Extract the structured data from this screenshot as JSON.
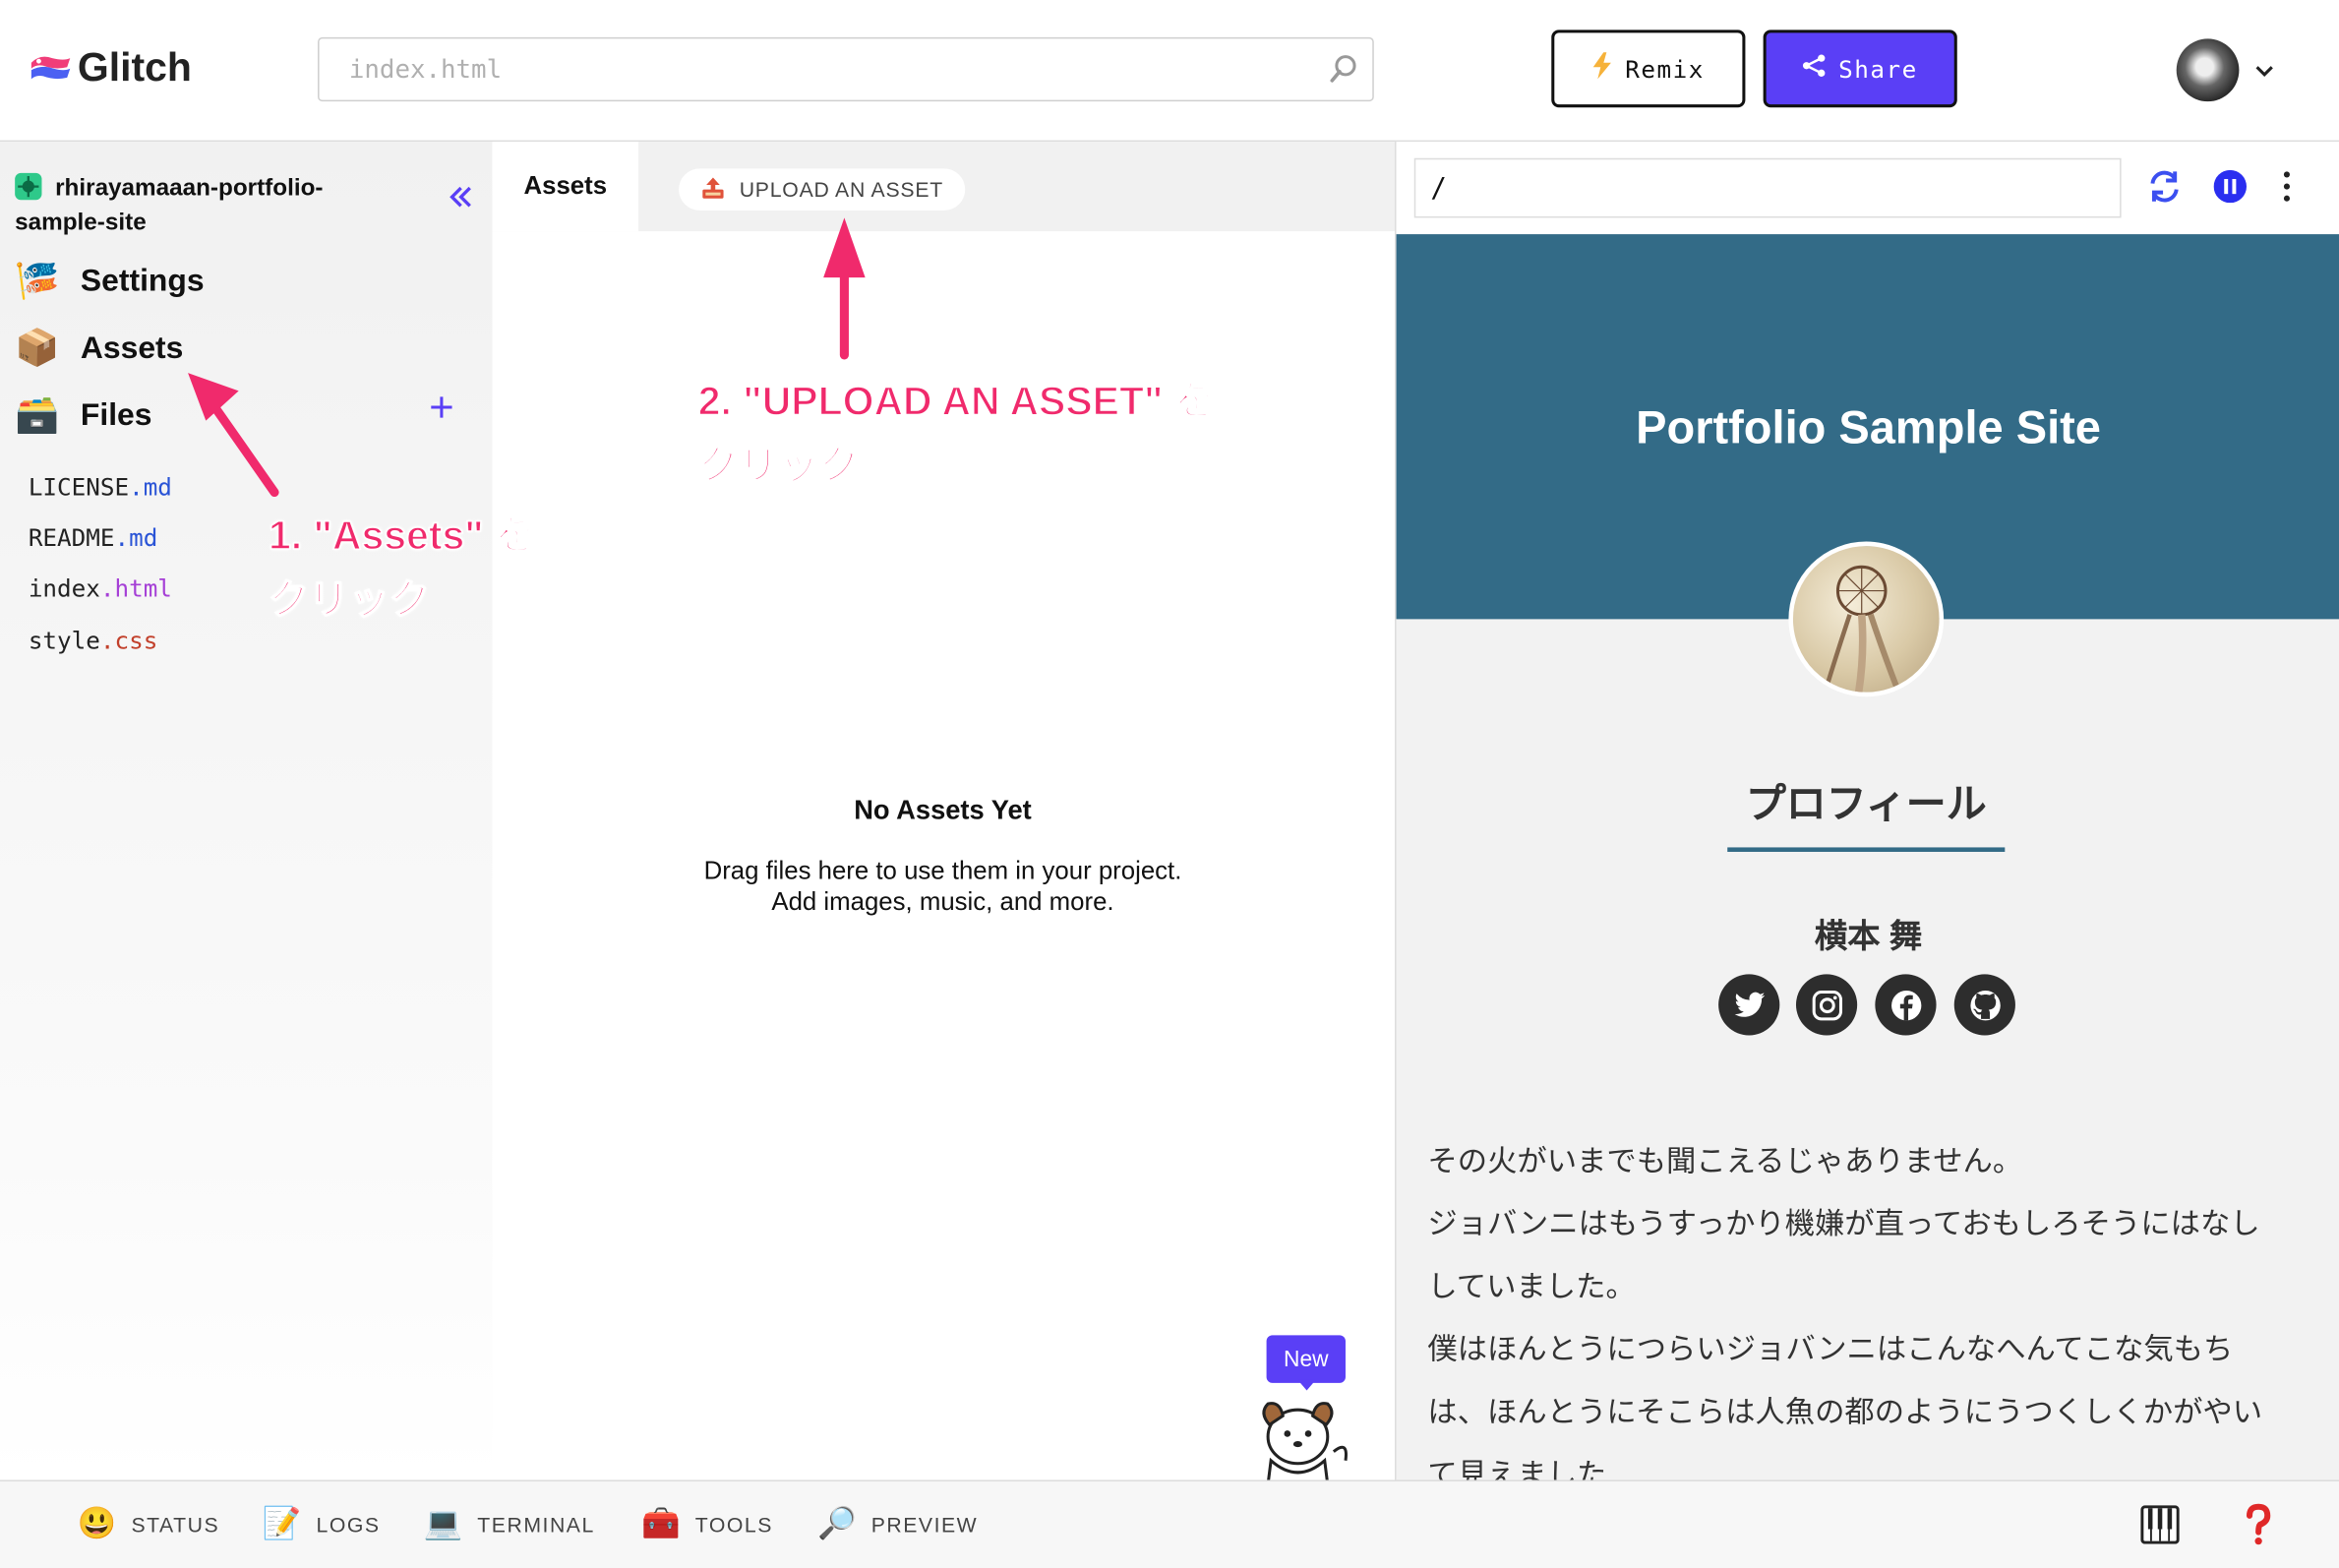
{
  "header": {
    "app_name": "Glitch",
    "search_placeholder": "index.html",
    "remix_label": "Remix",
    "share_label": "Share"
  },
  "sidebar": {
    "project_name": "rhirayamaaan-portfolio-sample-site",
    "nav": [
      {
        "label": "Settings",
        "icon": "carp-streamer-icon"
      },
      {
        "label": "Assets",
        "icon": "package-icon"
      },
      {
        "label": "Files",
        "icon": "file-cabinet-icon"
      }
    ],
    "files": [
      {
        "name": "LICENSE",
        "ext": ".md"
      },
      {
        "name": "README",
        "ext": ".md"
      },
      {
        "name": "index",
        "ext": ".html"
      },
      {
        "name": "style",
        "ext": ".css"
      }
    ]
  },
  "assets_panel": {
    "tab_label": "Assets",
    "upload_label": "UPLOAD AN ASSET",
    "empty_title": "No Assets Yet",
    "empty_line1": "Drag files here to use them in your project.",
    "empty_line2": "Add images, music, and more.",
    "new_badge": "New"
  },
  "preview": {
    "url": "/",
    "site_title": "Portfolio Sample Site",
    "profile_heading": "プロフィール",
    "person_name": "横本 舞",
    "social_icons": [
      "twitter-icon",
      "instagram-icon",
      "facebook-icon",
      "github-icon"
    ],
    "body_lines": [
      "その火がいまでも聞こえるじゃありません。",
      "ジョバンニはもうすっかり機嫌が直っておもしろそうにはなし",
      "していました。",
      "僕はほんとうにつらいジョバンニはこんなへんてこな気もち",
      "は、ほんとうにそこらは人魚の都のようにうつくしくかがやい",
      "て見えました"
    ]
  },
  "bottom_bar": {
    "items": [
      {
        "label": "STATUS",
        "icon": "smiley-icon"
      },
      {
        "label": "LOGS",
        "icon": "memo-icon"
      },
      {
        "label": "TERMINAL",
        "icon": "laptop-icon"
      },
      {
        "label": "TOOLS",
        "icon": "toolbox-icon"
      },
      {
        "label": "PREVIEW",
        "icon": "magnifier-icon"
      }
    ]
  },
  "annotations": {
    "step1_line1": "1. \"Assets\" を",
    "step1_line2": "クリック",
    "step2_line1": "2. \"UPLOAD AN ASSET\" を",
    "step2_line2": "クリック"
  },
  "colors": {
    "accent": "#5a3ff6",
    "hero": "#336b87",
    "annotation": "#f02a6c"
  }
}
